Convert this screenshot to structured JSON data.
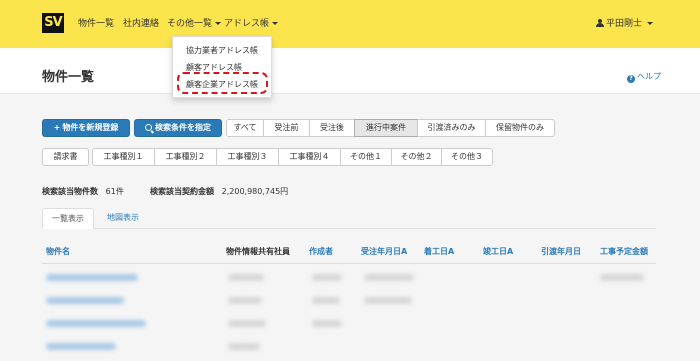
{
  "navbar": {
    "logo": "SV",
    "items": [
      "物件一覧",
      "社内連絡",
      "その他一覧",
      "アドレス帳"
    ],
    "user": "平田剛士"
  },
  "dropdown": {
    "items": [
      "協力業者アドレス帳",
      "顧客アドレス帳",
      "顧客企業アドレス帳"
    ]
  },
  "page": {
    "title": "物件一覧",
    "help": "ヘルプ"
  },
  "buttons": {
    "new_property": "物件を新規登録",
    "search": "検索条件を指定"
  },
  "filters": [
    "すべて",
    "受注前",
    "受注後",
    "進行中案件",
    "引渡済みのみ",
    "保留物件のみ"
  ],
  "categories": [
    "請求書",
    "工事種別１",
    "工事種別２",
    "工事種別３",
    "工事種別４",
    "その他１",
    "その他２",
    "その他３"
  ],
  "summary": {
    "count_label": "検索該当物件数",
    "count_value": "61件",
    "amount_label": "検索該当契約金額",
    "amount_value": "2,200,980,745円"
  },
  "tabs": [
    "一覧表示",
    "地図表示"
  ],
  "table": {
    "headers": [
      "物件名",
      "物件情報共有社員",
      "作成者",
      "受注年月日A",
      "着工日A",
      "竣工日A",
      "引渡年月日",
      "工事予定金額"
    ]
  },
  "colors": {
    "navbar": "#fce54c",
    "primary": "#2a7ab8",
    "highlight": "#d8161b"
  }
}
